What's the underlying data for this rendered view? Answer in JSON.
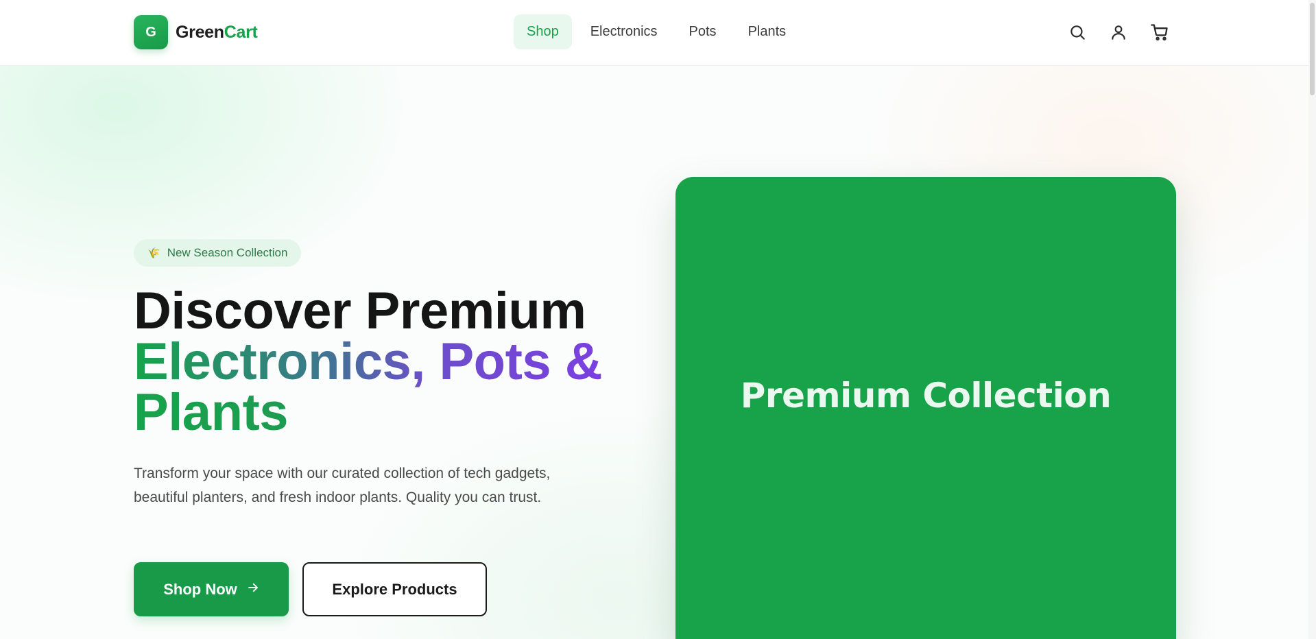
{
  "header": {
    "logo_letter": "G",
    "brand_part1": "Green",
    "brand_part2": "Cart",
    "nav": [
      {
        "label": "Shop",
        "active": true
      },
      {
        "label": "Electronics",
        "active": false
      },
      {
        "label": "Pots",
        "active": false
      },
      {
        "label": "Plants",
        "active": false
      }
    ],
    "icons": [
      "search-icon",
      "user-icon",
      "cart-icon"
    ]
  },
  "hero": {
    "badge_icon": "🌾",
    "badge_text": "New Season Collection",
    "title_line1": "Discover Premium",
    "title_line2": "Electronics, Pots &",
    "title_line3": "Plants",
    "description": "Transform your space with our curated collection of tech gadgets, beautiful planters, and fresh indoor plants. Quality you can trust.",
    "primary_button": "Shop Now",
    "secondary_button": "Explore Products",
    "card_title": "Premium Collection"
  },
  "colors": {
    "brand": "#16a34a",
    "card": "#18a34a",
    "gradient_end": "#7b3fe0"
  }
}
